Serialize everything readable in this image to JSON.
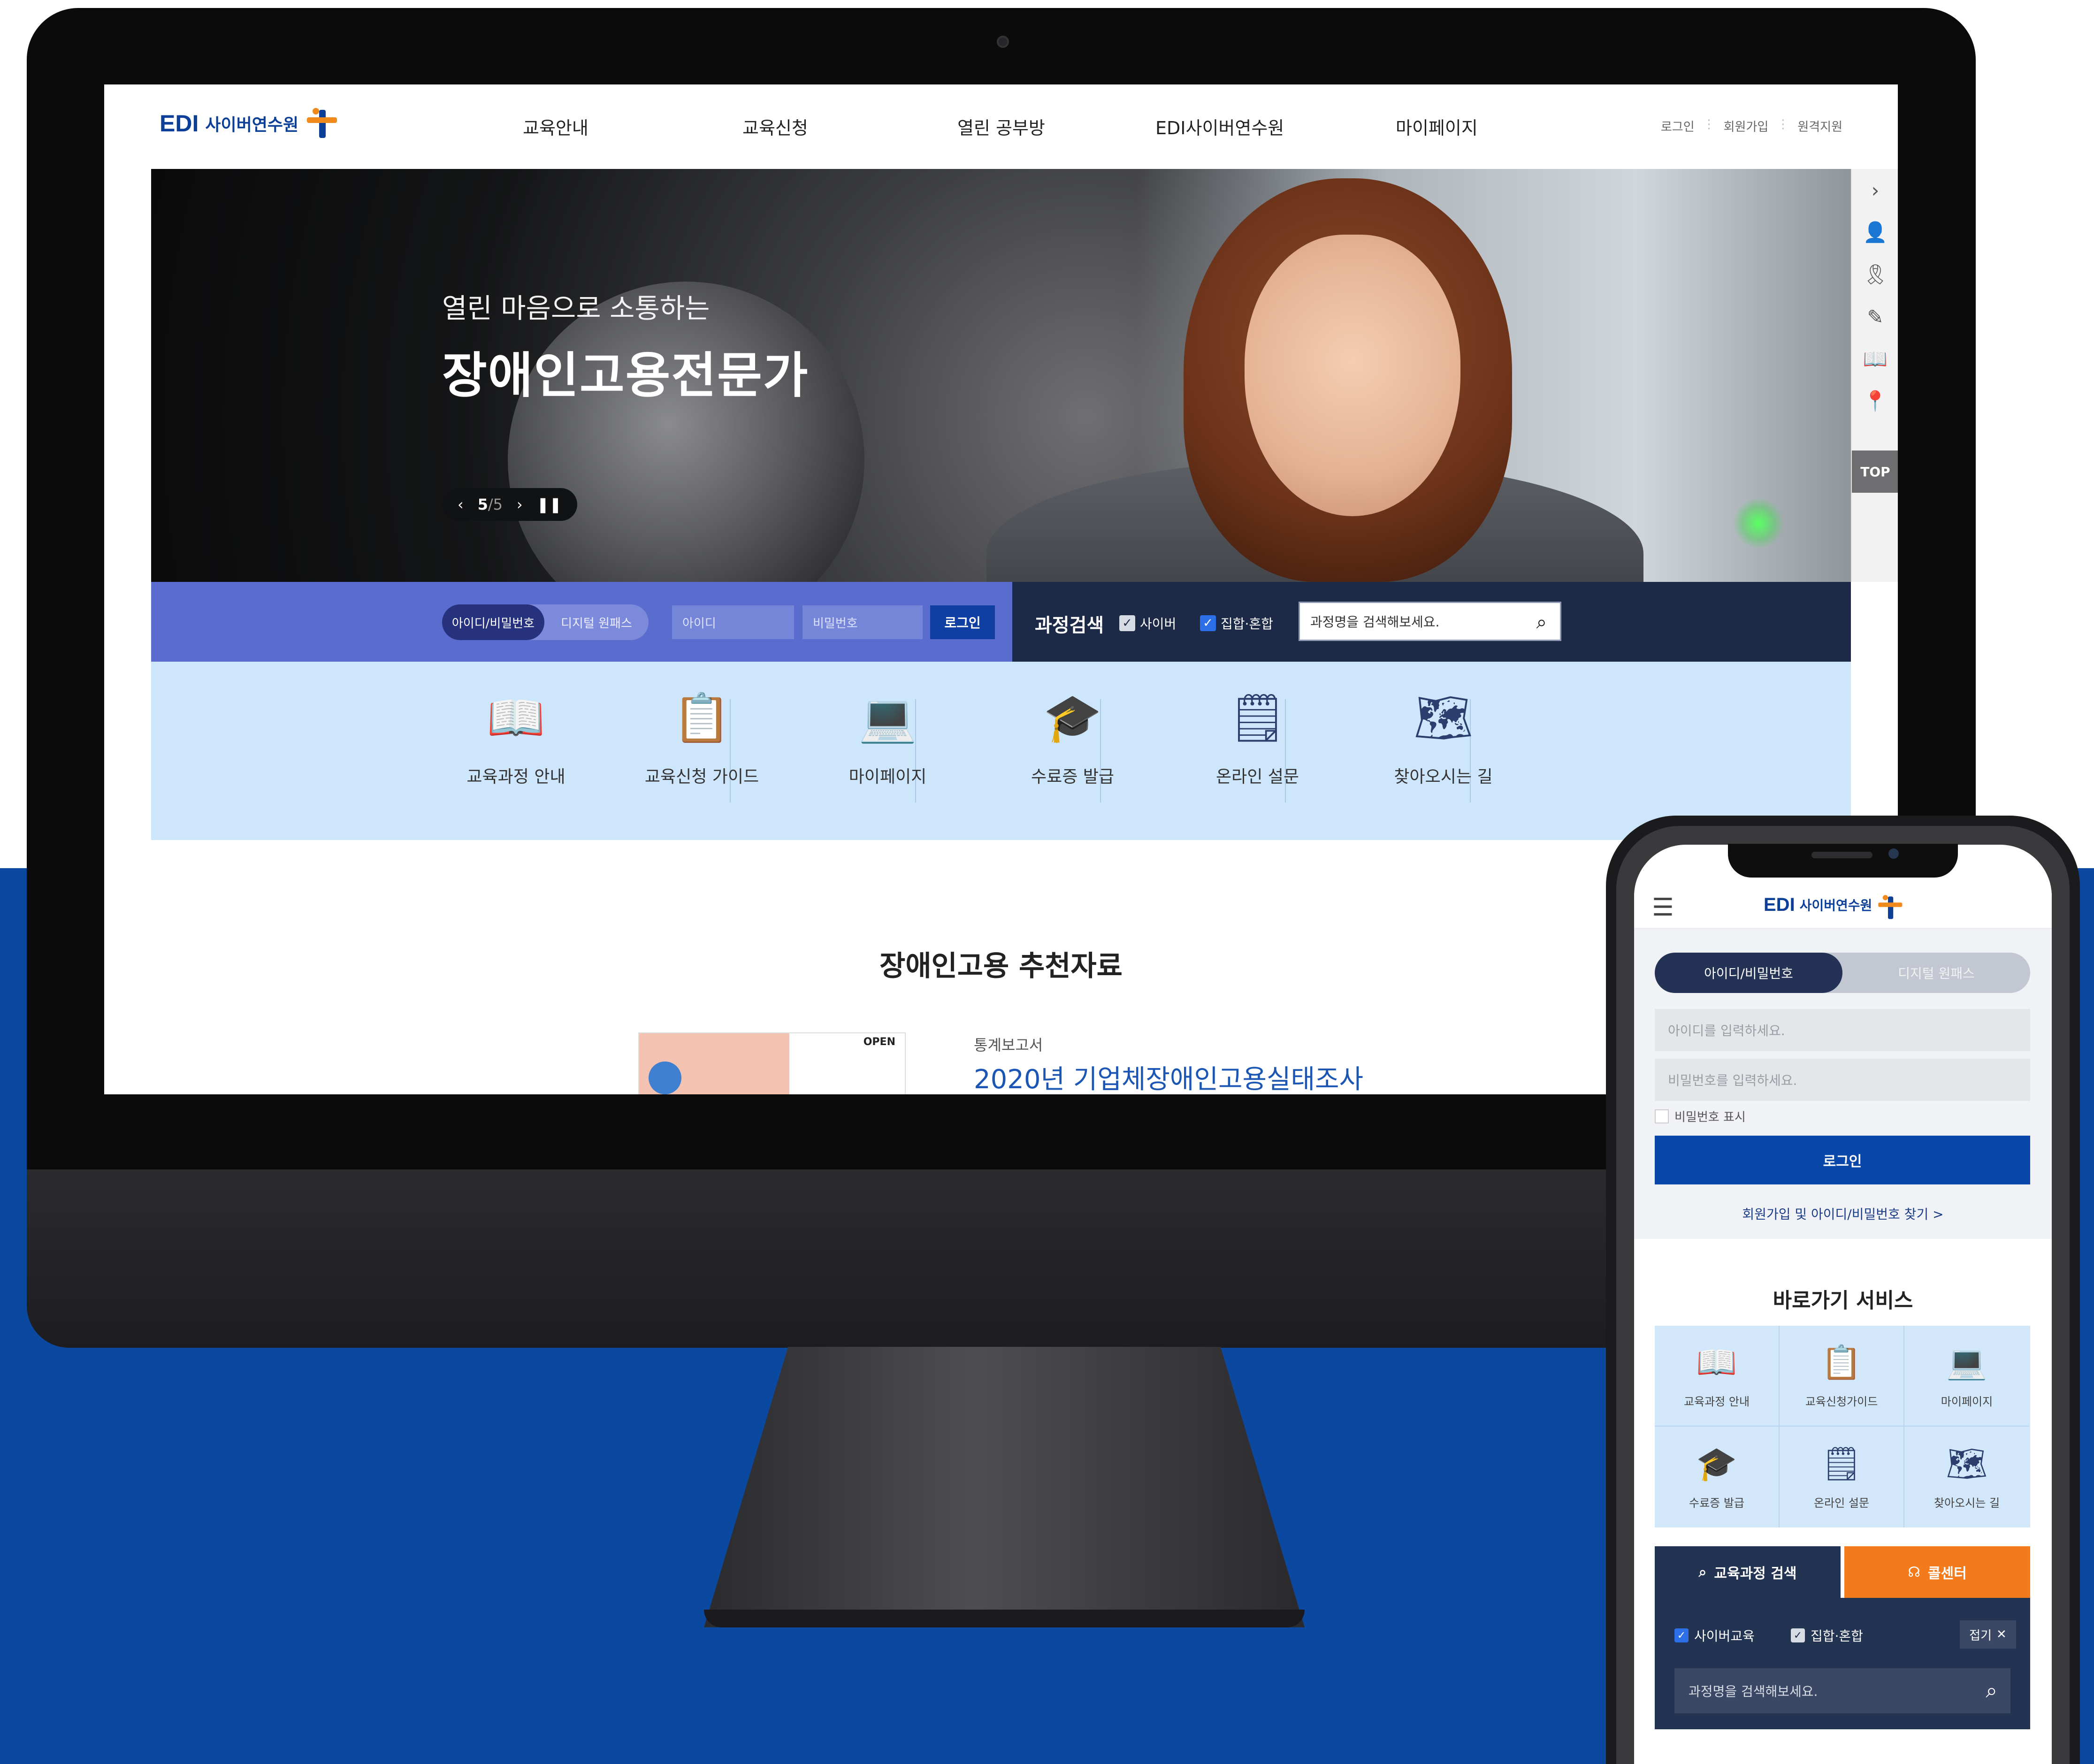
{
  "desktop": {
    "logo": {
      "edi": "EDI",
      "name": "사이버연수원"
    },
    "nav": [
      "교육안내",
      "교육신청",
      "열린 공부방",
      "EDI사이버연수원",
      "마이페이지"
    ],
    "util": [
      "로그인",
      "회원가입",
      "원격지원"
    ],
    "hero": {
      "subtitle": "열린 마음으로 소통하는",
      "title": "장애인고용전문가",
      "slide_current": "5",
      "slide_total": "/5"
    },
    "sidebar": {
      "top_label": "TOP"
    },
    "login": {
      "tab_active": "아이디/비밀번호",
      "tab_inactive": "디지털 원패스",
      "id_placeholder": "아이디",
      "pw_placeholder": "비밀번호",
      "button": "로그인"
    },
    "search": {
      "label": "과정검색",
      "check1": "사이버",
      "check2": "집합·혼합",
      "placeholder": "과정명을 검색해보세요."
    },
    "quick_menu": [
      "교육과정 안내",
      "교육신청 가이드",
      "마이페이지",
      "수료증 발급",
      "온라인 설문",
      "찾아오시는 길"
    ],
    "recommend": {
      "title": "장애인고용 추천자료",
      "tag": "통계보고서",
      "item_title": "2020년 기업체장애인고용실태조사",
      "thumb_open": "OPEN"
    }
  },
  "mobile": {
    "logo": {
      "edi": "EDI",
      "name": "사이버연수원"
    },
    "login": {
      "tab_active": "아이디/비밀번호",
      "tab_inactive": "디지털 원패스",
      "id_placeholder": "아이디를 입력하세요.",
      "pw_placeholder": "비밀번호를 입력하세요.",
      "show_pw": "비밀번호 표시",
      "button": "로그인",
      "join_link": "회원가입 및 아이디/비밀번호 찾기 >"
    },
    "services": {
      "title": "바로가기 서비스",
      "items": [
        "교육과정 안내",
        "교육신청가이드",
        "마이페이지",
        "수료증 발급",
        "온라인 설문",
        "찾아오시는 길"
      ]
    },
    "tabs": {
      "search": "교육과정 검색",
      "call": "콜센터"
    },
    "search": {
      "check1": "사이버교육",
      "check2": "집합·혼합",
      "fold": "접기",
      "placeholder": "과정명을 검색해보세요."
    }
  },
  "colors": {
    "brand_blue": "#0b3f98",
    "band_blue": "#0b48a0",
    "accent_orange": "#f47b1c",
    "navy": "#233352"
  }
}
